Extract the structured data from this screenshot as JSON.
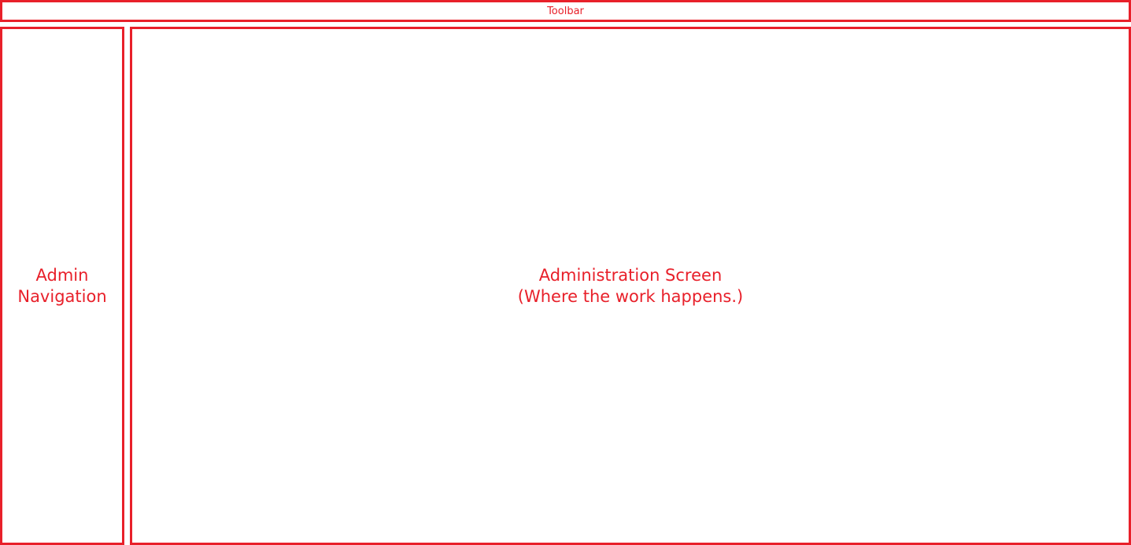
{
  "toolbar": {
    "label": "Toolbar"
  },
  "admin_navigation": {
    "line1": "Admin",
    "line2": "Navigation"
  },
  "administration_screen": {
    "line1": "Administration Screen",
    "line2": "(Where the work happens.)"
  },
  "colors": {
    "accent": "#e8202a",
    "background": "#ffffff"
  }
}
